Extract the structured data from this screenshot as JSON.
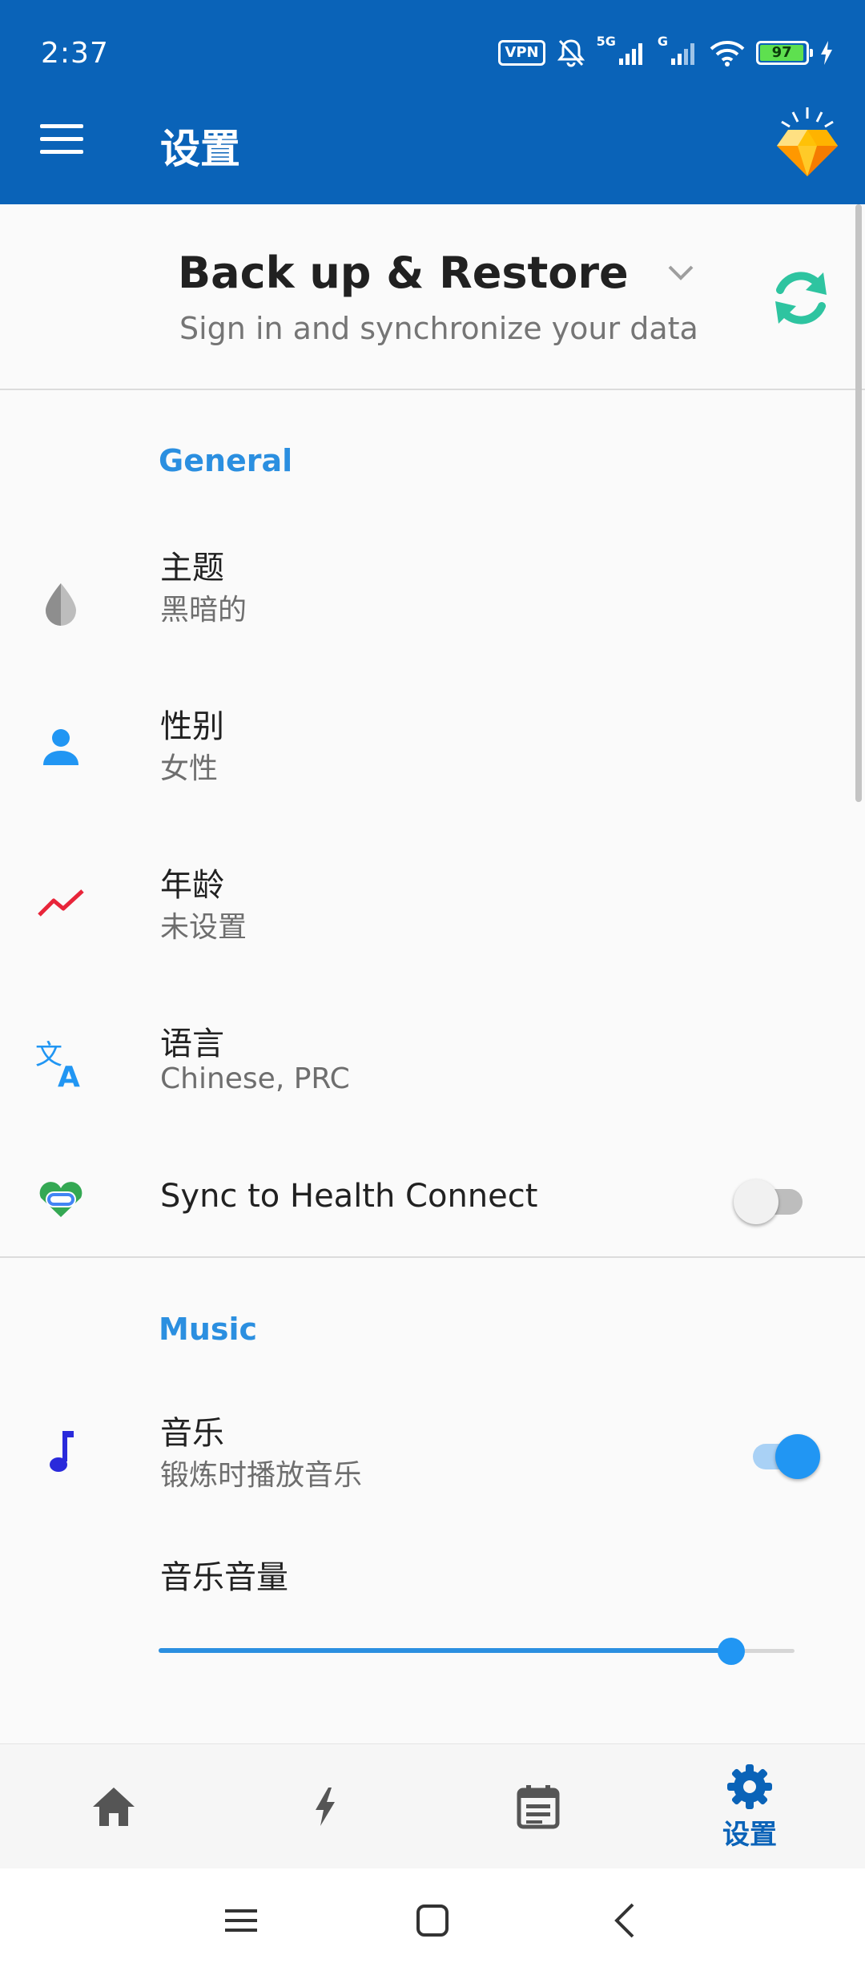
{
  "status_bar": {
    "time": "2:37",
    "vpn_label": "VPN",
    "network_label_1": "5G",
    "network_label_2": "G",
    "battery_level": "97"
  },
  "app_bar": {
    "title": "设置",
    "menu_icon": "hamburger-icon",
    "premium_icon": "diamond-icon"
  },
  "backup": {
    "title": "Back up & Restore",
    "subtitle": "Sign in and synchronize your data"
  },
  "general": {
    "header": "General",
    "items": [
      {
        "title": "主题",
        "value": "黑暗的",
        "icon": "water-drop-icon"
      },
      {
        "title": "性别",
        "value": "女性",
        "icon": "person-icon"
      },
      {
        "title": "年龄",
        "value": "未设置",
        "icon": "trending-line-icon"
      },
      {
        "title": "语言",
        "value": "Chinese, PRC",
        "icon": "translate-icon"
      }
    ],
    "health_connect": {
      "title": "Sync to Health Connect",
      "enabled": false
    }
  },
  "music": {
    "header": "Music",
    "music_toggle": {
      "title": "音乐",
      "subtitle": "锻炼时播放音乐",
      "enabled": true
    },
    "volume": {
      "title": "音乐音量",
      "level": 0.9
    }
  },
  "bottom_nav": {
    "items": [
      {
        "name": "home",
        "icon": "home-icon"
      },
      {
        "name": "lightning",
        "icon": "lightning-icon"
      },
      {
        "name": "calendar",
        "icon": "calendar-icon"
      },
      {
        "name": "settings",
        "icon": "gear-icon",
        "label": "设置",
        "active": true
      }
    ]
  },
  "colors": {
    "app_bar": "#0a63b8",
    "accent": "#2196f3",
    "section_header": "#2b8fe0"
  }
}
